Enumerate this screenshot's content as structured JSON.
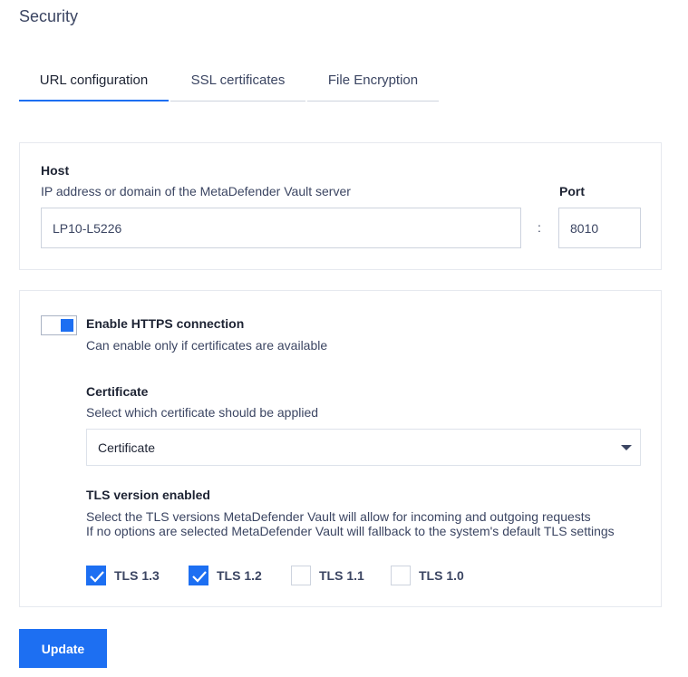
{
  "page_title": "Security",
  "tabs": [
    {
      "label": "URL configuration",
      "active": true
    },
    {
      "label": "SSL certificates",
      "active": false
    },
    {
      "label": "File Encryption",
      "active": false
    }
  ],
  "host": {
    "label": "Host",
    "description": "IP address or domain of the MetaDefender Vault server",
    "value": "LP10-L5226",
    "separator": ":"
  },
  "port": {
    "label": "Port",
    "value": "8010"
  },
  "https": {
    "enabled": true,
    "label": "Enable HTTPS connection",
    "description": "Can enable only if certificates are available"
  },
  "certificate": {
    "label": "Certificate",
    "description": "Select which certificate should be applied",
    "selected": "Certificate"
  },
  "tls": {
    "label": "TLS version enabled",
    "description_line1": "Select the TLS versions MetaDefender Vault will allow for incoming and outgoing requests",
    "description_line2": "If no options are selected MetaDefender Vault will fallback to the system's default TLS settings",
    "options": [
      {
        "label": "TLS 1.3",
        "checked": true
      },
      {
        "label": "TLS 1.2",
        "checked": true
      },
      {
        "label": "TLS 1.1",
        "checked": false
      },
      {
        "label": "TLS 1.0",
        "checked": false
      }
    ]
  },
  "actions": {
    "update_label": "Update"
  },
  "colors": {
    "accent": "#1d6ff2",
    "text_primary": "#1d2333",
    "text_secondary": "#3b4562",
    "border": "#cdd3de"
  },
  "icons": {
    "dropdown": "caret-down-icon",
    "checkbox_checked": "check-icon"
  }
}
